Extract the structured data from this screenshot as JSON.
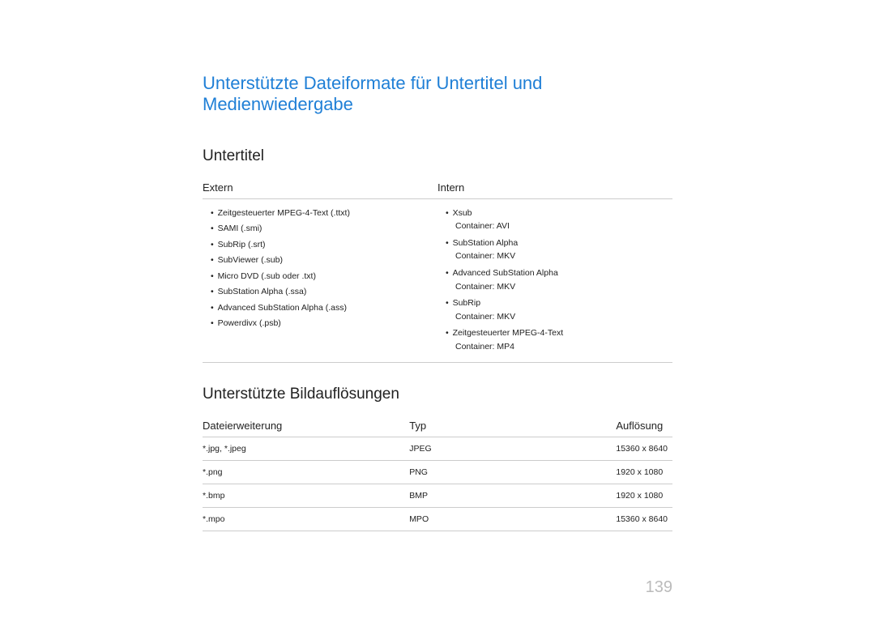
{
  "main_title": "Unterstützte Dateiformate für Untertitel und Medienwiedergabe",
  "section1": {
    "title": "Untertitel",
    "headers": {
      "extern": "Extern",
      "intern": "Intern"
    },
    "extern": [
      {
        "text": "Zeitgesteuerter MPEG-4-Text (.ttxt)"
      },
      {
        "text": "SAMI (.smi)"
      },
      {
        "text": "SubRip (.srt)"
      },
      {
        "text": "SubViewer (.sub)"
      },
      {
        "text": "Micro DVD (.sub oder .txt)"
      },
      {
        "text": "SubStation Alpha (.ssa)"
      },
      {
        "text": "Advanced SubStation Alpha (.ass)"
      },
      {
        "text": "Powerdivx (.psb)"
      }
    ],
    "intern": [
      {
        "text": "Xsub",
        "sub": "Container: AVI"
      },
      {
        "text": "SubStation Alpha",
        "sub": "Container: MKV"
      },
      {
        "text": "Advanced SubStation Alpha",
        "sub": "Container: MKV"
      },
      {
        "text": "SubRip",
        "sub": "Container: MKV"
      },
      {
        "text": "Zeitgesteuerter MPEG-4-Text",
        "sub": "Container: MP4"
      }
    ]
  },
  "section2": {
    "title": "Unterstützte Bildauflösungen",
    "headers": {
      "ext": "Dateierweiterung",
      "type": "Typ",
      "res": "Auflösung"
    },
    "rows": [
      {
        "ext": "*.jpg, *.jpeg",
        "type": "JPEG",
        "res": "15360 x 8640"
      },
      {
        "ext": "*.png",
        "type": "PNG",
        "res": "1920 x 1080"
      },
      {
        "ext": "*.bmp",
        "type": "BMP",
        "res": "1920 x 1080"
      },
      {
        "ext": "*.mpo",
        "type": "MPO",
        "res": "15360 x 8640"
      }
    ]
  },
  "page_number": "139"
}
